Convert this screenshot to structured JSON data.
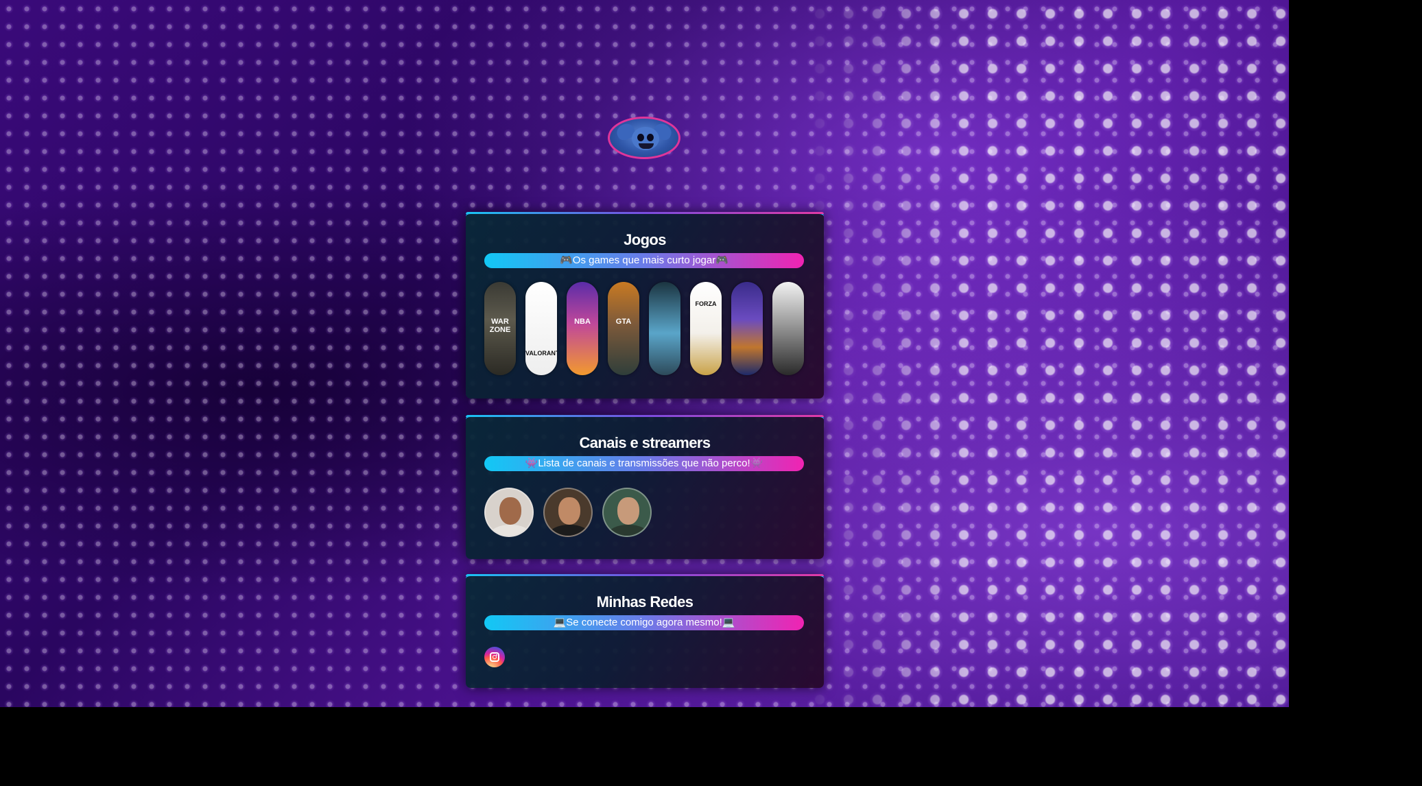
{
  "profile": {
    "avatar_icon": "stitch-avatar-icon"
  },
  "sections": {
    "games": {
      "title": "Jogos",
      "subtitle": "🎮Os games que mais curto jogar🎮",
      "items": [
        {
          "label": "WAR ZONE",
          "icon": "warzone-cover-icon"
        },
        {
          "label": "VALORANT",
          "icon": "valorant-cover-icon"
        },
        {
          "label": "NBA",
          "icon": "nba-cover-icon"
        },
        {
          "label": "GTA",
          "icon": "gta-cover-icon"
        },
        {
          "label": "",
          "icon": "fifa-cover-icon"
        },
        {
          "label": "FORZA",
          "icon": "forza-cover-icon"
        },
        {
          "label": "",
          "icon": "sports-cover-icon"
        },
        {
          "label": "",
          "icon": "batman-cover-icon"
        }
      ]
    },
    "streamers": {
      "title": "Canais e streamers",
      "subtitle": "👾Lista de canais e transmissões que não perco!👾",
      "items": [
        {
          "icon": "streamer-1-avatar"
        },
        {
          "icon": "streamer-2-avatar"
        },
        {
          "icon": "streamer-3-avatar"
        }
      ]
    },
    "socials": {
      "title": "Minhas Redes",
      "subtitle": "💻Se conecte comigo agora mesmo!💻",
      "items": [
        {
          "icon": "instagram-icon"
        }
      ]
    }
  }
}
